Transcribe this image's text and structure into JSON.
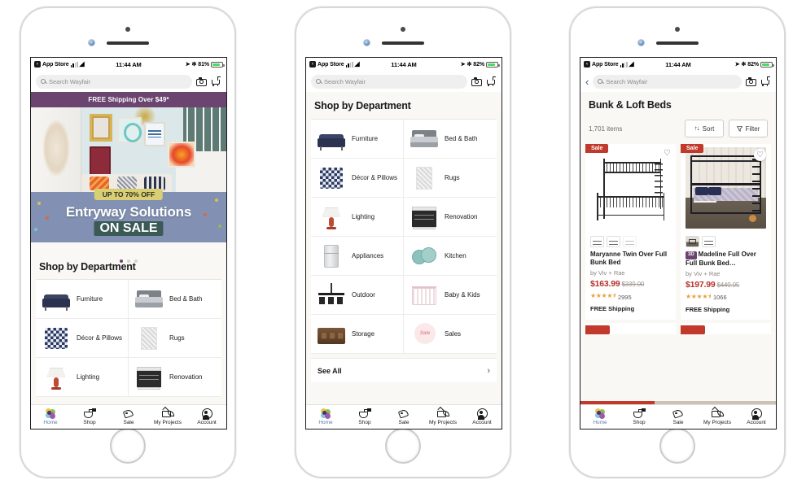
{
  "status_bar": {
    "app_label": "App Store",
    "app_icon": "back-arrow-icon",
    "wifi_icon": "wifi-icon",
    "time": "11:44 AM",
    "location_icon": "location-arrow-icon",
    "bluetooth_icon": "bluetooth-icon",
    "battery_1": "81%",
    "battery_2": "82%",
    "battery_3": "82%"
  },
  "search": {
    "placeholder": "Search Wayfair",
    "camera_icon": "camera-icon",
    "cart_icon": "shopping-cart-icon",
    "back_icon": "chevron-left-icon"
  },
  "promo": {
    "text": "FREE Shipping Over $49*"
  },
  "hero": {
    "badge": "UP TO 70% OFF",
    "headline": "Entryway Solutions",
    "subhead": "ON SALE",
    "dots": 3,
    "active_dot": 0
  },
  "departments": {
    "title": "Shop by Department",
    "items": [
      {
        "label": "Furniture",
        "icon": "sofa-icon"
      },
      {
        "label": "Bed & Bath",
        "icon": "bed-icon"
      },
      {
        "label": "Décor & Pillows",
        "icon": "pillow-icon"
      },
      {
        "label": "Rugs",
        "icon": "rug-icon"
      },
      {
        "label": "Lighting",
        "icon": "lamp-icon"
      },
      {
        "label": "Renovation",
        "icon": "cabinet-icon"
      },
      {
        "label": "Appliances",
        "icon": "refrigerator-icon"
      },
      {
        "label": "Kitchen",
        "icon": "plates-icon"
      },
      {
        "label": "Outdoor",
        "icon": "patio-set-icon"
      },
      {
        "label": "Baby & Kids",
        "icon": "crib-icon"
      },
      {
        "label": "Storage",
        "icon": "sideboard-icon"
      },
      {
        "label": "Sales",
        "icon": "sale-circle-icon"
      }
    ],
    "see_all": "See All",
    "see_all_chevron": "chevron-right-icon"
  },
  "listing": {
    "title": "Bunk & Loft Beds",
    "count": "1,701 items",
    "sort_label": "Sort",
    "sort_icon": "sort-arrows-icon",
    "filter_label": "Filter",
    "filter_icon": "funnel-icon",
    "products": [
      {
        "badge": "Sale",
        "name": "Maryanne Twin Over Full Bunk Bed",
        "brand": "by Viv + Rae",
        "price": "$163.99",
        "was_price": "$339.00",
        "stars": "★★★★⯨",
        "rating_count": "2995",
        "shipping": "FREE Shipping",
        "has_3d": false,
        "favorite_icon": "heart-outline-icon",
        "swatch_count": 3
      },
      {
        "badge": "Sale",
        "name": "Madeline Full Over Full Bunk Bed…",
        "badge_3d": "3D",
        "brand": "by Viv + Rae",
        "price": "$197.99",
        "was_price": "$449.05",
        "stars": "★★★★⯨",
        "rating_count": "1066",
        "shipping": "FREE Shipping",
        "has_3d": true,
        "favorite_icon": "heart-outline-icon",
        "swatch_count": 2
      }
    ]
  },
  "tabbar": {
    "items": [
      {
        "label": "Home",
        "icon": "flower-home-icon",
        "active": true
      },
      {
        "label": "Shop",
        "icon": "shopping-bag-icon",
        "active": false
      },
      {
        "label": "Sale",
        "icon": "price-tag-icon",
        "active": false
      },
      {
        "label": "My Projects",
        "icon": "house-heart-icon",
        "active": false
      },
      {
        "label": "Account",
        "icon": "account-avatar-icon",
        "active": false
      }
    ]
  },
  "colors": {
    "brand_purple": "#6b4570",
    "sale_red": "#c0392b",
    "price_red": "#b5332c",
    "active_tab": "#5a7fa8",
    "hero_yellow": "#d8cf74"
  }
}
